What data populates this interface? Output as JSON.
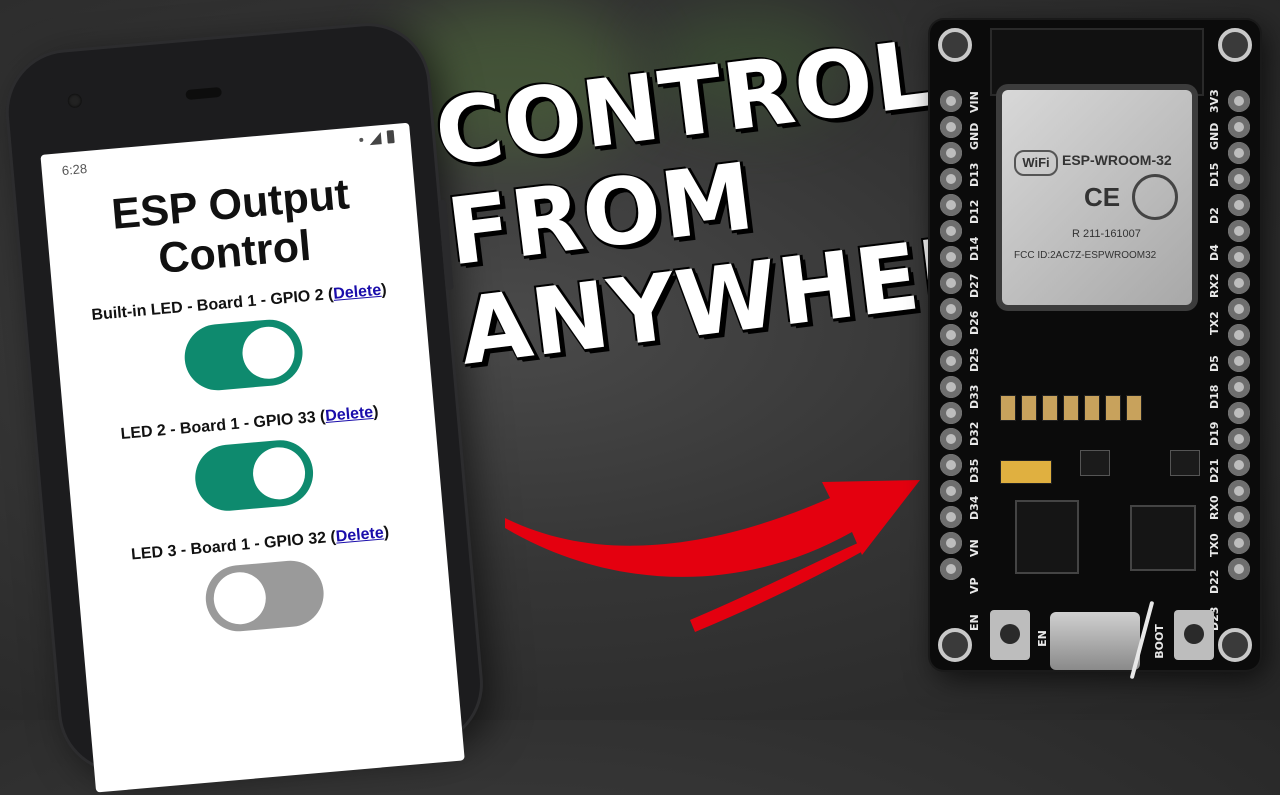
{
  "phone": {
    "status_time": "6:28",
    "page_title": "ESP Output\nControl",
    "outputs": [
      {
        "label": "Built-in LED - Board 1 - GPIO 2",
        "delete_label": "Delete",
        "state": "on"
      },
      {
        "label": "LED 2 - Board 1 - GPIO 33",
        "delete_label": "Delete",
        "state": "on"
      },
      {
        "label": "LED 3 - Board 1 - GPIO 32",
        "delete_label": "Delete",
        "state": "off"
      }
    ]
  },
  "headline": {
    "line1": "CONTROL",
    "line2": "FROM",
    "line3": "ANYWHERE"
  },
  "board": {
    "module_name": "ESP-WROOM-32",
    "module_cert": "R 211-161007",
    "module_fcc": "FCC ID:2AC7Z-ESPWROOM32",
    "wifi_text": "WiFi",
    "ce_text": "CE",
    "left_pins": [
      "VIN",
      "GND",
      "D13",
      "D12",
      "D14",
      "D27",
      "D26",
      "D25",
      "D33",
      "D32",
      "D35",
      "D34",
      "VN",
      "VP",
      "EN"
    ],
    "right_pins": [
      "3V3",
      "GND",
      "D15",
      "D2",
      "D4",
      "RX2",
      "TX2",
      "D5",
      "D18",
      "D19",
      "D21",
      "RX0",
      "TX0",
      "D22",
      "D23"
    ],
    "btn_left_label": "EN",
    "btn_right_label": "BOOT"
  },
  "colors": {
    "switch_on": "#0e8a6e",
    "switch_off": "#9a9a9a",
    "arrow": "#e4000f",
    "link": "#1a0dab"
  }
}
